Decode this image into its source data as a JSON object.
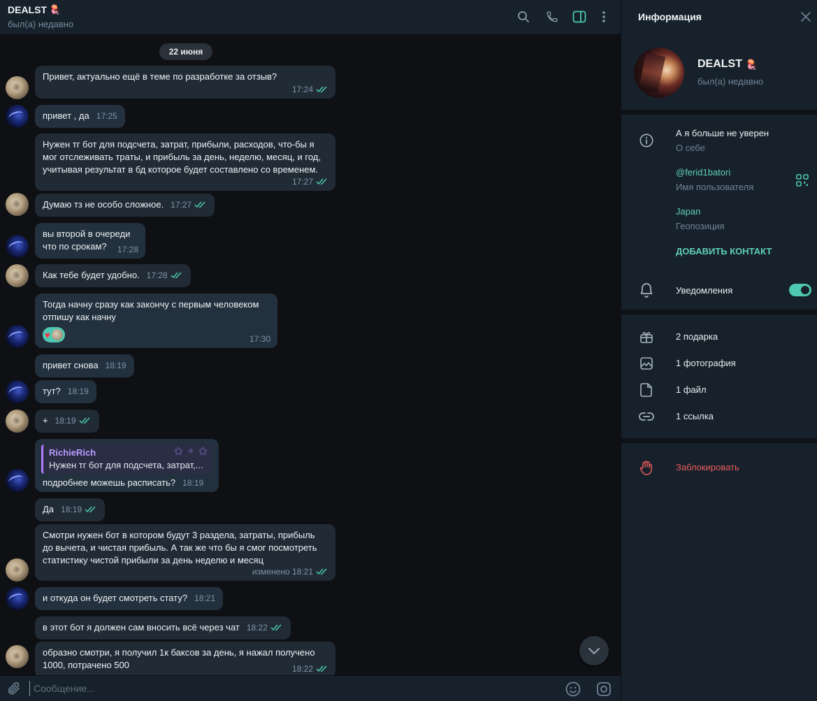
{
  "chat": {
    "header": {
      "title": "DEALST",
      "title_emoji": "🪼",
      "status": "был(а) недавно"
    },
    "date_divider": "22 июня",
    "messages": [
      {
        "side": "a",
        "text": "Привет, актуально ещё в теме по разработке за отзыв?",
        "time": "17:24",
        "read": true
      },
      {
        "side": "b",
        "text": "привет , да",
        "time": "17:25",
        "read": false
      },
      {
        "side": "a",
        "text": "Нужен тг бот для подсчета, затрат, прибыли, расходов, что-бы я\nмог отслеживать траты, и прибыль за день, неделю, месяц, и год,\nучитывая результат в бд которое будет составлено со временем.",
        "time": "17:27",
        "read": true
      },
      {
        "side": "a",
        "text": "Думаю тз не особо сложное.",
        "time": "17:27",
        "read": true
      },
      {
        "side": "b",
        "text": "вы второй в очереди\nчто по срокам?",
        "time": "17:28",
        "read": false
      },
      {
        "side": "a",
        "text": "Как тебе будет удобно.",
        "time": "17:28",
        "read": true
      },
      {
        "side": "b",
        "text": "Тогда начну сразу как закончу с первым человеком\nотпишу как начну",
        "time": "17:30",
        "read": false,
        "reaction": "♥"
      },
      {
        "side": "b",
        "text": "привет снова",
        "time": "18:19",
        "read": false
      },
      {
        "side": "b",
        "text": "тут?",
        "time": "18:19",
        "read": false
      },
      {
        "side": "a",
        "text": "+",
        "time": "18:19",
        "read": true
      },
      {
        "side": "b",
        "reply_name": "RichieRich",
        "reply_text": "Нужен тг бот для подсчета, затрат,...",
        "text": "подробнее можешь расписать?",
        "time": "18:19",
        "read": false
      },
      {
        "side": "a",
        "text": "Да",
        "time": "18:19",
        "read": true
      },
      {
        "side": "a",
        "text": "Смотри нужен бот в котором будут 3 раздела, затраты, прибыль\nдо вычета, и чистая прибыль. А так же что бы я смог посмотреть\nстатистику чистой прибыли за день неделю и месяц",
        "time": "изменено 18:21",
        "read": true
      },
      {
        "side": "b",
        "text": "и откуда он будет смотреть стату?",
        "time": "18:21",
        "read": false
      },
      {
        "side": "a",
        "text": "в этот бот я должен сам вносить всё через чат",
        "time": "18:22",
        "read": true
      },
      {
        "side": "a",
        "text": "образно смотри, я получил 1к баксов за день, я нажал получено\n1000, потрачено 500",
        "time": "18:22",
        "read": true
      }
    ],
    "composer": {
      "placeholder": "Сообщение..."
    }
  },
  "info": {
    "title": "Информация",
    "name": "DEALST",
    "name_emoji": "🪼",
    "status": "был(а) недавно",
    "about": {
      "value": "А я больше не уверен",
      "label": "О себе"
    },
    "username": {
      "value": "@ferid1batori",
      "label": "Имя пользователя"
    },
    "location": {
      "value": "Japan",
      "label": "Геопозиция"
    },
    "add_contact": "ДОБАВИТЬ КОНТАКТ",
    "notifications": {
      "label": "Уведомления",
      "enabled": true
    },
    "media": {
      "gifts": "2 подарка",
      "photos": "1 фотография",
      "files": "1 файл",
      "links": "1 ссылка"
    },
    "block": "Заблокировать"
  },
  "colors": {
    "accent": "#4cc9b0",
    "danger": "#ec5a5a",
    "reply_name": "#b99bff",
    "panel": "#17212b",
    "bubble": "#212b36"
  },
  "icons": [
    "search-icon",
    "phone-icon",
    "sidebar-toggle-icon",
    "more-vertical-icon",
    "close-icon",
    "info-icon",
    "qr-code-icon",
    "bell-icon",
    "gift-icon",
    "photo-icon",
    "file-icon",
    "link-icon",
    "hand-block-icon",
    "paperclip-icon",
    "emoji-icon",
    "camera-icon",
    "chevron-down-icon",
    "double-check-icon"
  ]
}
